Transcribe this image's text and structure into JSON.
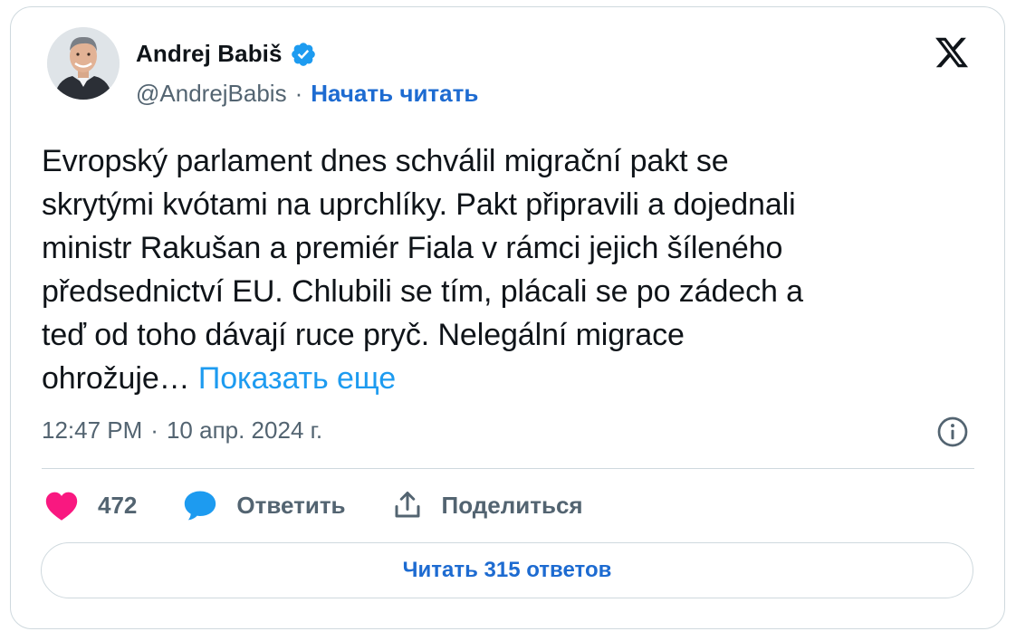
{
  "tweet": {
    "author": {
      "name": "Andrej Babiš",
      "handle": "@AndrejBabis",
      "verified": true,
      "follow_label": "Начать читать",
      "separator": "·"
    },
    "lines": [
      "Evropský parlament dnes schválil migrační pakt se",
      "skrytými kvótami na uprchlíky. Pakt připravili a dojednali",
      "ministr Rakušan a premiér Fiala v rámci jejich šíleného",
      "předsednictví EU. Chlubili se tím, plácali se po zádech a",
      "teď od toho dávají ruce pryč. Nelegální migrace"
    ],
    "last_line": "ohrožuje…",
    "show_more_label": "Показать еще",
    "time": "12:47 PM",
    "meta_separator": "·",
    "date": "10 апр. 2024 г.",
    "likes_count": "472",
    "reply_label": "Ответить",
    "share_label": "Поделиться",
    "read_replies_label": "Читать 315 ответов"
  },
  "icons": {
    "platform_logo": "x-logo-icon",
    "verified": "verified-badge-icon",
    "info": "info-icon",
    "like": "heart-icon",
    "reply": "speech-bubble-icon",
    "share": "share-upload-icon"
  },
  "colors": {
    "link": "#1d6bd1",
    "show_more": "#1d9bf0",
    "verified": "#1d9bf0",
    "heart": "#f91880",
    "reply_bubble": "#1d9bf0",
    "muted_text": "#536471",
    "border": "#cfd9de"
  }
}
